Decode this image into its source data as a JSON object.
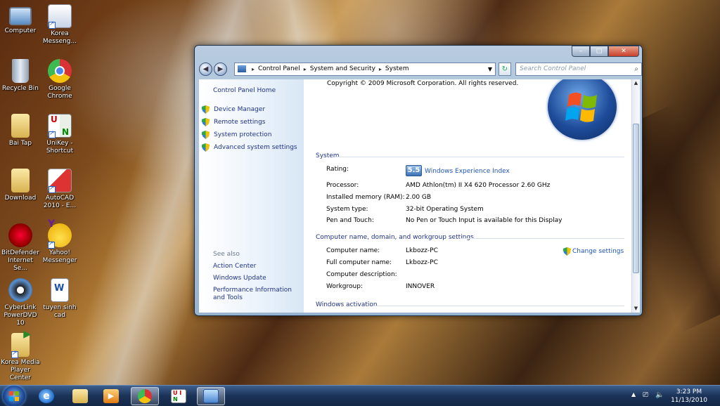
{
  "desktop": {
    "icons": [
      {
        "label": "Computer"
      },
      {
        "label": "Korea Messeng..."
      },
      {
        "label": "Recycle Bin"
      },
      {
        "label": "Google Chrome"
      },
      {
        "label": "Bai Tap"
      },
      {
        "label": "UniKey - Shortcut"
      },
      {
        "label": "Download"
      },
      {
        "label": "AutoCAD 2010 - E..."
      },
      {
        "label": "BitDefender Internet Se..."
      },
      {
        "label": "Yahoo! Messenger"
      },
      {
        "label": "CyberLink PowerDVD 10"
      },
      {
        "label": "tuyen sinh cad"
      },
      {
        "label": "Korea Media Player Center"
      }
    ]
  },
  "window": {
    "caption": {
      "min": "–",
      "max": "□",
      "close": "✕"
    },
    "address": {
      "crumbs": [
        "Control Panel",
        "System and Security",
        "System"
      ],
      "search_placeholder": "Search Control Panel"
    },
    "left_pane": {
      "home": "Control Panel Home",
      "tasks": [
        "Device Manager",
        "Remote settings",
        "System protection",
        "Advanced system settings"
      ],
      "see_also_title": "See also",
      "see_also": [
        "Action Center",
        "Windows Update",
        "Performance Information and Tools"
      ]
    },
    "content": {
      "copyright": "Copyright © 2009 Microsoft Corporation.  All rights reserved.",
      "system_title": "System",
      "rating_label": "Rating:",
      "rating_score": "5.5",
      "rating_link": "Windows Experience Index",
      "processor_label": "Processor:",
      "processor_value": "AMD Athlon(tm) II X4 620 Processor   2.60 GHz",
      "memory_label": "Installed memory (RAM):",
      "memory_value": "2.00 GB",
      "systype_label": "System type:",
      "systype_value": "32-bit Operating System",
      "pen_label": "Pen and Touch:",
      "pen_value": "No Pen or Touch Input is available for this Display",
      "computer_title": "Computer name, domain, and workgroup settings",
      "compname_label": "Computer name:",
      "compname_value": "Lkbozz-PC",
      "fullname_label": "Full computer name:",
      "fullname_value": "Lkbozz-PC",
      "desc_label": "Computer description:",
      "desc_value": "",
      "workgroup_label": "Workgroup:",
      "workgroup_value": "INNOVER",
      "change_settings": "Change settings",
      "activation_title": "Windows activation"
    }
  },
  "taskbar": {
    "time": "3:23 PM",
    "date": "11/13/2010"
  }
}
